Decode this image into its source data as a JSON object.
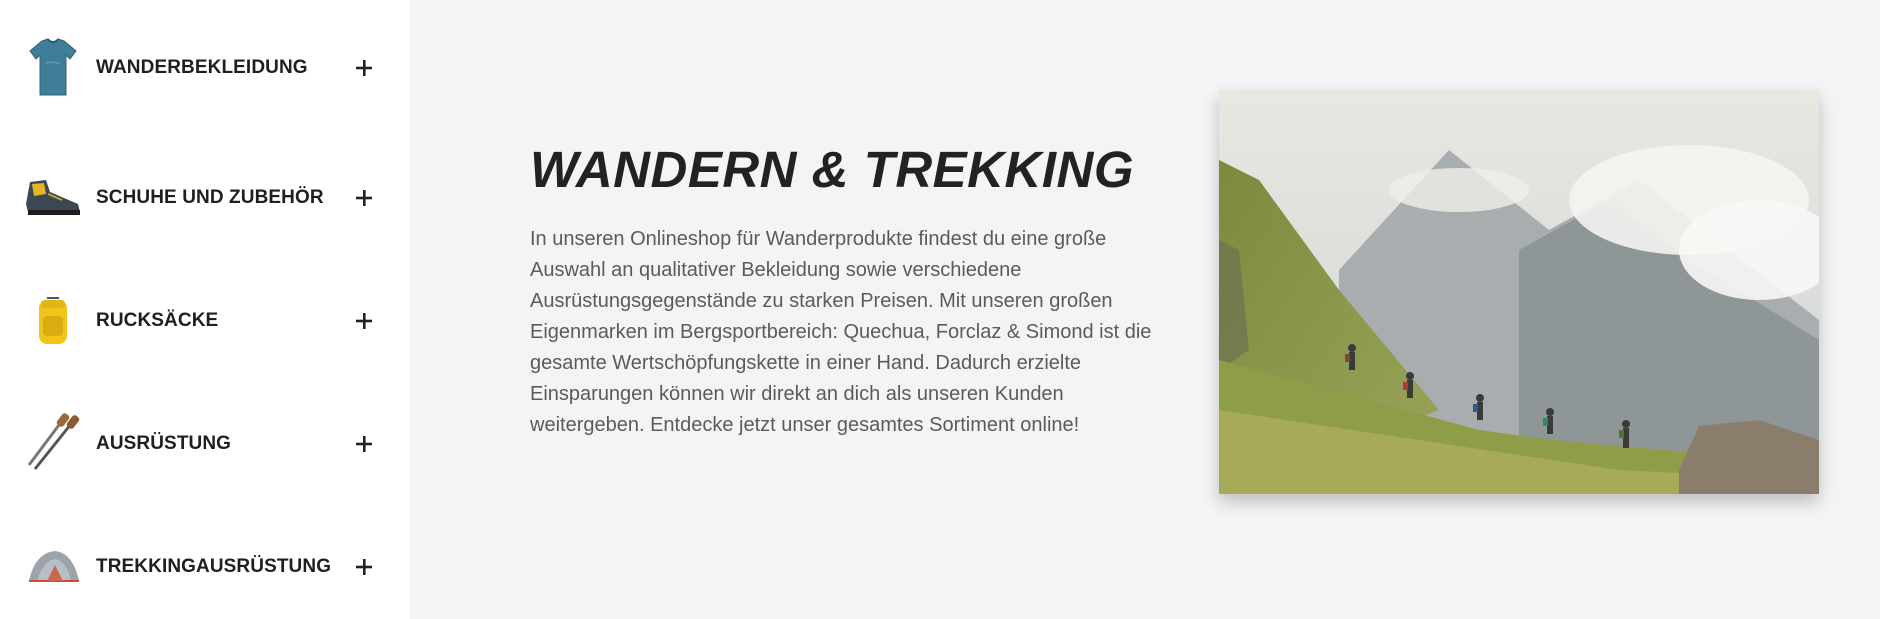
{
  "sidebar": {
    "items": [
      {
        "label": "WANDERBEKLEIDUNG",
        "icon": "tshirt-icon"
      },
      {
        "label": "SCHUHE UND ZUBEHÖR",
        "icon": "hiking-boot-icon"
      },
      {
        "label": "RUCKSÄCKE",
        "icon": "backpack-icon"
      },
      {
        "label": "AUSRÜSTUNG",
        "icon": "trekking-poles-icon"
      },
      {
        "label": "TREKKINGAUSRÜSTUNG",
        "icon": "tent-icon"
      }
    ],
    "expand_icon": "plus-icon"
  },
  "main": {
    "title": "WANDERN & TREKKING",
    "description": "In unseren Onlineshop für Wanderprodukte findest du eine große Auswahl an qualitativer Bekleidung sowie verschiedene Ausrüstungsgegenstände zu starken Preisen. Mit unseren großen Eigenmarken im Bergsportbereich: Quechua, Forclaz & Simond ist die gesamte Wertschöpfungskette in einer Hand. Dadurch erzielte Einsparungen können wir direkt an dich als unseren Kunden weitergeben. Entdecke jetzt unser gesamtes Sortiment online!"
  },
  "colors": {
    "sidebar_bg": "#ffffff",
    "main_bg": "#f3f4f6",
    "title": "#222222",
    "body_text": "#5b5b5b"
  }
}
